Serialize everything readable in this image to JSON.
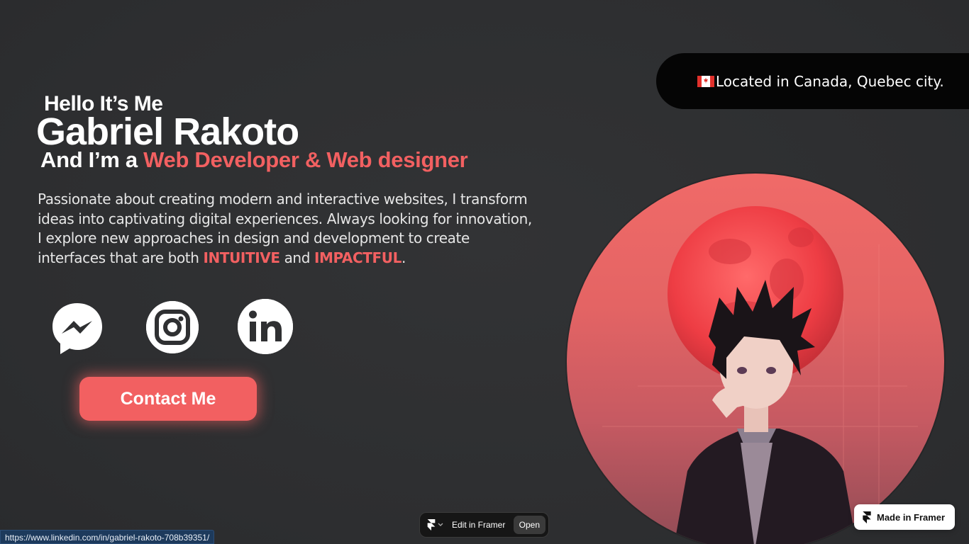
{
  "location": {
    "flag_icon": "canada-flag-icon",
    "text": "Located in Canada, Quebec city."
  },
  "hero": {
    "greeting": "Hello It’s Me",
    "name": "Gabriel Rakoto",
    "role_prefix": "And I’m a ",
    "role_highlight": "Web Developer & Web designer",
    "description_part1": "Passionate about creating modern and interactive websites, I transform ideas into captivating digital experiences. Always looking for innovation, I explore new approaches in design and development to create interfaces that are both ",
    "description_highlight1": "INTUITIVE",
    "description_and": " and ",
    "description_highlight2": "IMPACTFUL",
    "description_end": "."
  },
  "socials": [
    {
      "icon": "messenger-icon"
    },
    {
      "icon": "instagram-icon"
    },
    {
      "icon": "linkedin-icon"
    }
  ],
  "contact_button": {
    "label": "Contact Me"
  },
  "framer_bar": {
    "edit_label": "Edit in Framer",
    "open_label": "Open"
  },
  "made_in_framer": {
    "label": "Made in Framer"
  },
  "status_bar": {
    "url": "https://www.linkedin.com/in/gabriel-rakoto-708b39351/"
  },
  "colors": {
    "accent": "#f26061",
    "background": "#2f3032",
    "pill": "#050505"
  }
}
